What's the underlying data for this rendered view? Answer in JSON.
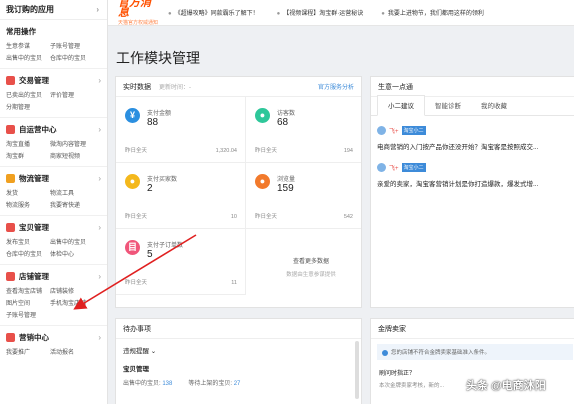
{
  "sidebar": {
    "header": "我订购的应用",
    "groups": [
      {
        "title": "常用操作",
        "color": "",
        "links": [
          "生意参谋",
          "子账号管理",
          "出售中的宝贝",
          "仓库中的宝贝"
        ]
      },
      {
        "title": "交易管理",
        "color": "#e8504a",
        "links": [
          "已卖出的宝贝",
          "评价管理",
          "分期管理"
        ]
      },
      {
        "title": "自运营中心",
        "color": "#e8504a",
        "links": [
          "淘宝直播",
          "微淘内容管理",
          "淘宝群",
          "商家短视频"
        ]
      },
      {
        "title": "物流管理",
        "color": "#f0a020",
        "links": [
          "发货",
          "物流工具",
          "物流服务",
          "我要寄快递"
        ]
      },
      {
        "title": "宝贝管理",
        "color": "#e8504a",
        "links": [
          "发布宝贝",
          "出售中的宝贝",
          "仓库中的宝贝",
          "体检中心"
        ]
      },
      {
        "title": "店铺管理",
        "color": "#e8504a",
        "links": [
          "查看淘宝店铺",
          "店铺装修",
          "图片空间",
          "手机淘宝店铺",
          "子账号管理"
        ]
      },
      {
        "title": "营销中心",
        "color": "#e8504a",
        "links": [
          "我要推广",
          "活动报名"
        ]
      }
    ]
  },
  "topbar": {
    "logo": "官方消息",
    "logo_sub": "天猫官方权威通知",
    "news": [
      {
        "mark": "●",
        "text": "《超爆攻略》同款霸乐了解下！"
      },
      {
        "mark": "●",
        "text": "【视频课程】淘宝群·运营秘诀"
      },
      {
        "mark": "●",
        "text": "我要上进物节，我们都用这样的领利"
      }
    ]
  },
  "page_title": "工作模块管理",
  "realtime": {
    "title": "实时数据",
    "updated": "更新时间：-",
    "link": "官方服务分析",
    "metrics": [
      {
        "icon": "¥",
        "color": "#2b8fe0",
        "label": "支付金额",
        "value": "88",
        "yesterday": "昨日全天",
        "y_value": "1,320.04"
      },
      {
        "icon": "●",
        "color": "#2ec79a",
        "label": "访客数",
        "value": "68",
        "yesterday": "昨日全天",
        "y_value": "194"
      },
      {
        "icon": "●",
        "color": "#f4b81c",
        "label": "支付买家数",
        "value": "2",
        "yesterday": "昨日全天",
        "y_value": "10"
      },
      {
        "icon": "●",
        "color": "#f27a2c",
        "label": "浏览量",
        "value": "159",
        "yesterday": "昨日全天",
        "y_value": "542"
      },
      {
        "icon": "目",
        "color": "#f0567a",
        "label": "支付子订单数",
        "value": "5",
        "yesterday": "昨日全天",
        "y_value": "11"
      }
    ],
    "more_title": "查看更多数据",
    "more_sub": "数据由生意参谋提供"
  },
  "news_feed": {
    "title": "生意一点通",
    "tabs": [
      "小二建议",
      "智能诊断",
      "我的收藏"
    ],
    "items": [
      {
        "tag": "淘宝小二",
        "text": "电商营销的入门按产品你还没开始？淘宝客是按照成交..."
      },
      {
        "tag": "淘宝小二",
        "text": "亲爱的卖家，淘宝客营销计划是你打造爆款，爆发式增..."
      }
    ]
  },
  "todo": {
    "title": "待办事项",
    "selector": "违规提醒 ⌄",
    "section": "宝贝管理",
    "stats": [
      {
        "label": "出售中的宝贝:",
        "value": "138"
      },
      {
        "label": "等待上架的宝贝:",
        "value": "27"
      }
    ]
  },
  "gold": {
    "title": "金牌卖家",
    "notice": "您的店铺不符合金牌卖家基础准入条件。",
    "question": "刷问时指正？",
    "answer": "本次金牌卖家考核，新的..."
  },
  "watermark": "头条 @电商沐阳"
}
